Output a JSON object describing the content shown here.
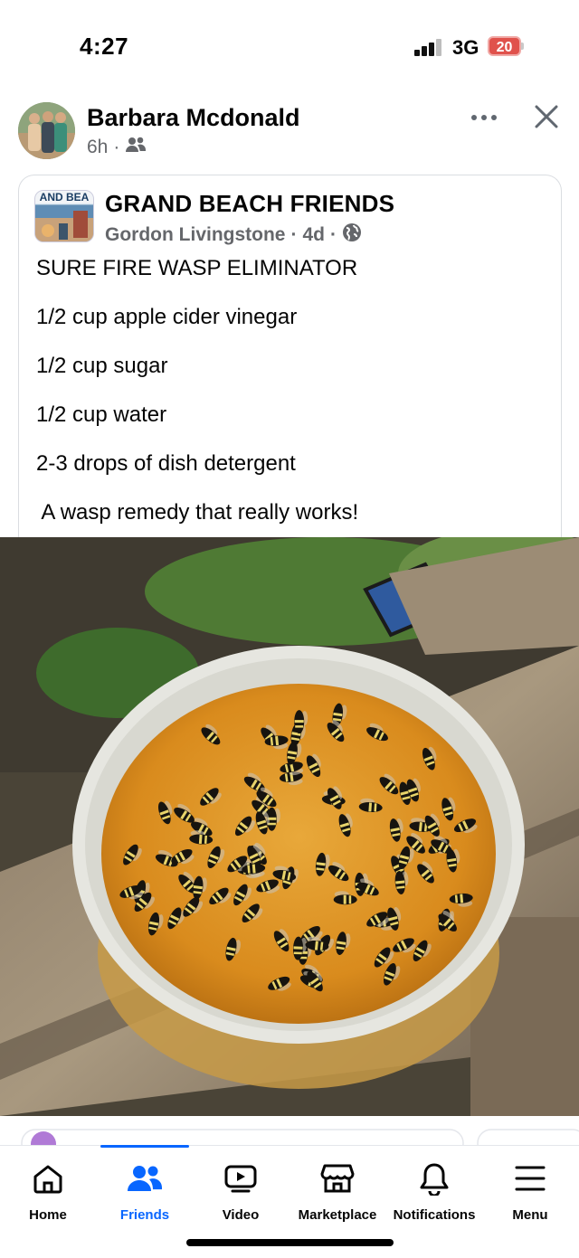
{
  "status_bar": {
    "time": "4:27",
    "network": "3G",
    "battery": "20"
  },
  "post": {
    "author": "Barbara Mcdonald",
    "time_ago": "6h",
    "separator": "·",
    "audience_icon": "friends-icon"
  },
  "shared": {
    "group_avatar_text": "AND BEA",
    "group_name": "GRAND BEACH FRIENDS",
    "author": "Gordon Livingstone",
    "time_ago": "4d",
    "separator": "·",
    "audience_icon": "globe-icon",
    "lines": [
      "SURE FIRE WASP ELIMINATOR",
      "1/2 cup apple cider vinegar",
      "1/2 cup sugar",
      "1/2 cup water",
      "2-3 drops of dish detergent",
      " A wasp remedy that really works!"
    ]
  },
  "nav": {
    "items": [
      {
        "label": "Home",
        "icon": "home-icon"
      },
      {
        "label": "Friends",
        "icon": "friends-icon"
      },
      {
        "label": "Video",
        "icon": "video-icon"
      },
      {
        "label": "Marketplace",
        "icon": "marketplace-icon"
      },
      {
        "label": "Notifications",
        "icon": "bell-icon"
      },
      {
        "label": "Menu",
        "icon": "menu-icon"
      }
    ],
    "active": "Friends",
    "active_color": "#0866ff"
  }
}
